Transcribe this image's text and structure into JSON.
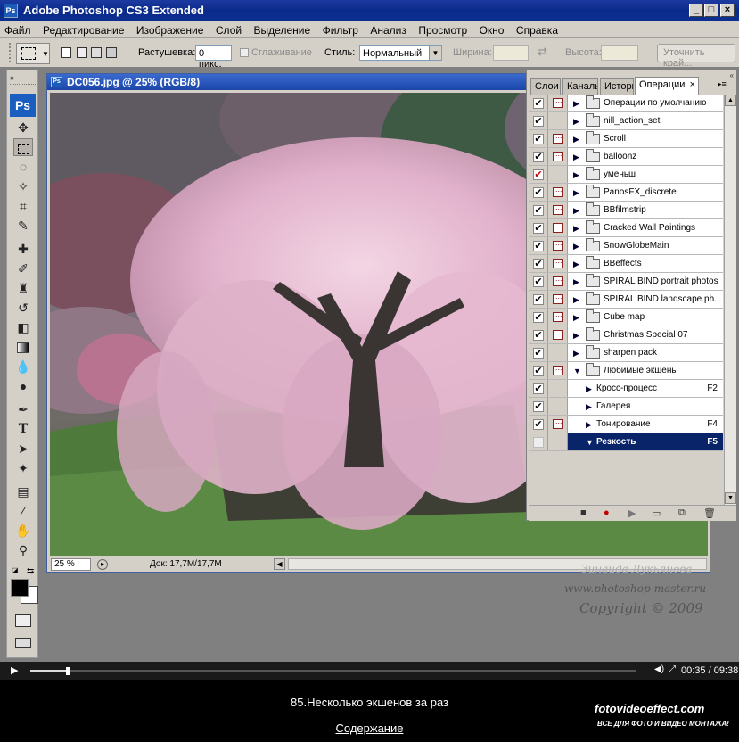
{
  "window": {
    "title": "Adobe Photoshop CS3 Extended",
    "app_icon": "Ps"
  },
  "menu": [
    "Файл",
    "Редактирование",
    "Изображение",
    "Слой",
    "Выделение",
    "Фильтр",
    "Анализ",
    "Просмотр",
    "Окно",
    "Справка"
  ],
  "options": {
    "feather_label": "Растушевка:",
    "feather_value": "0 пикс.",
    "antialias_label": "Сглаживание",
    "style_label": "Стиль:",
    "style_value": "Нормальный",
    "width_label": "Ширина:",
    "height_label": "Высота:",
    "refine_button": "Уточнить край..."
  },
  "toolbox": {
    "logo": "Ps"
  },
  "document": {
    "title": "DC056.jpg @ 25% (RGB/8)",
    "zoom": "25 %",
    "doc_size": "Док: 17,7M/17,7M"
  },
  "panel": {
    "tabs": [
      "Слои",
      "Каналы",
      "История",
      "Операции"
    ],
    "close_glyph": "×",
    "rows": [
      {
        "name": "Операции по умолчанию",
        "check": true,
        "dialog": true,
        "type": "set"
      },
      {
        "name": "nill_action_set",
        "check": true,
        "dialog": false,
        "type": "set"
      },
      {
        "name": "Scroll",
        "check": true,
        "dialog": true,
        "type": "set"
      },
      {
        "name": "balloonz",
        "check": true,
        "dialog": true,
        "type": "set"
      },
      {
        "name": "уменьш",
        "check": true,
        "dialog": false,
        "type": "set",
        "red": true
      },
      {
        "name": "PanosFX_discrete",
        "check": true,
        "dialog": true,
        "type": "set"
      },
      {
        "name": "BBfilmstrip",
        "check": true,
        "dialog": true,
        "type": "set"
      },
      {
        "name": "Cracked Wall Paintings",
        "check": true,
        "dialog": true,
        "type": "set"
      },
      {
        "name": "SnowGlobeMain",
        "check": true,
        "dialog": true,
        "type": "set"
      },
      {
        "name": "BBeffects",
        "check": true,
        "dialog": true,
        "type": "set"
      },
      {
        "name": "SPIRAL BIND portrait photos",
        "check": true,
        "dialog": true,
        "type": "set"
      },
      {
        "name": "SPIRAL BIND landscape ph...",
        "check": true,
        "dialog": true,
        "type": "set"
      },
      {
        "name": "Cube map",
        "check": true,
        "dialog": true,
        "type": "set"
      },
      {
        "name": "Christmas Special 07",
        "check": true,
        "dialog": true,
        "type": "set"
      },
      {
        "name": "sharpen pack",
        "check": true,
        "dialog": false,
        "type": "set"
      },
      {
        "name": "Любимые экшены",
        "check": true,
        "dialog": true,
        "type": "set",
        "expanded": true
      },
      {
        "name": "Кросс-процесс",
        "check": true,
        "dialog": false,
        "type": "action",
        "key": "F2"
      },
      {
        "name": "Галерея",
        "check": true,
        "dialog": false,
        "type": "action",
        "key": ""
      },
      {
        "name": "Тонирование",
        "check": true,
        "dialog": true,
        "type": "action",
        "key": "F4"
      },
      {
        "name": "Резкость",
        "check": false,
        "dialog": false,
        "type": "action",
        "key": "F5",
        "selected": true,
        "expanded": true
      }
    ]
  },
  "watermark": {
    "author": "Зинаида Лукьянова",
    "site": "www.photoshop-master.ru",
    "copyright": "Copyright © 2009"
  },
  "video": {
    "time": "00:35 / 09:38",
    "progress": 0.062,
    "caption": "85.Несколько экшенов за раз",
    "toc_link": "Содержание",
    "brand": "fotovideoeffect.com",
    "brand_sub": "ВСЕ ДЛЯ ФОТО И ВИДЕО МОНТАЖА!"
  },
  "colors": {
    "title_blue": "#0a2a8a",
    "selection": "#0a246a",
    "blossom": "#e6b7d0"
  }
}
